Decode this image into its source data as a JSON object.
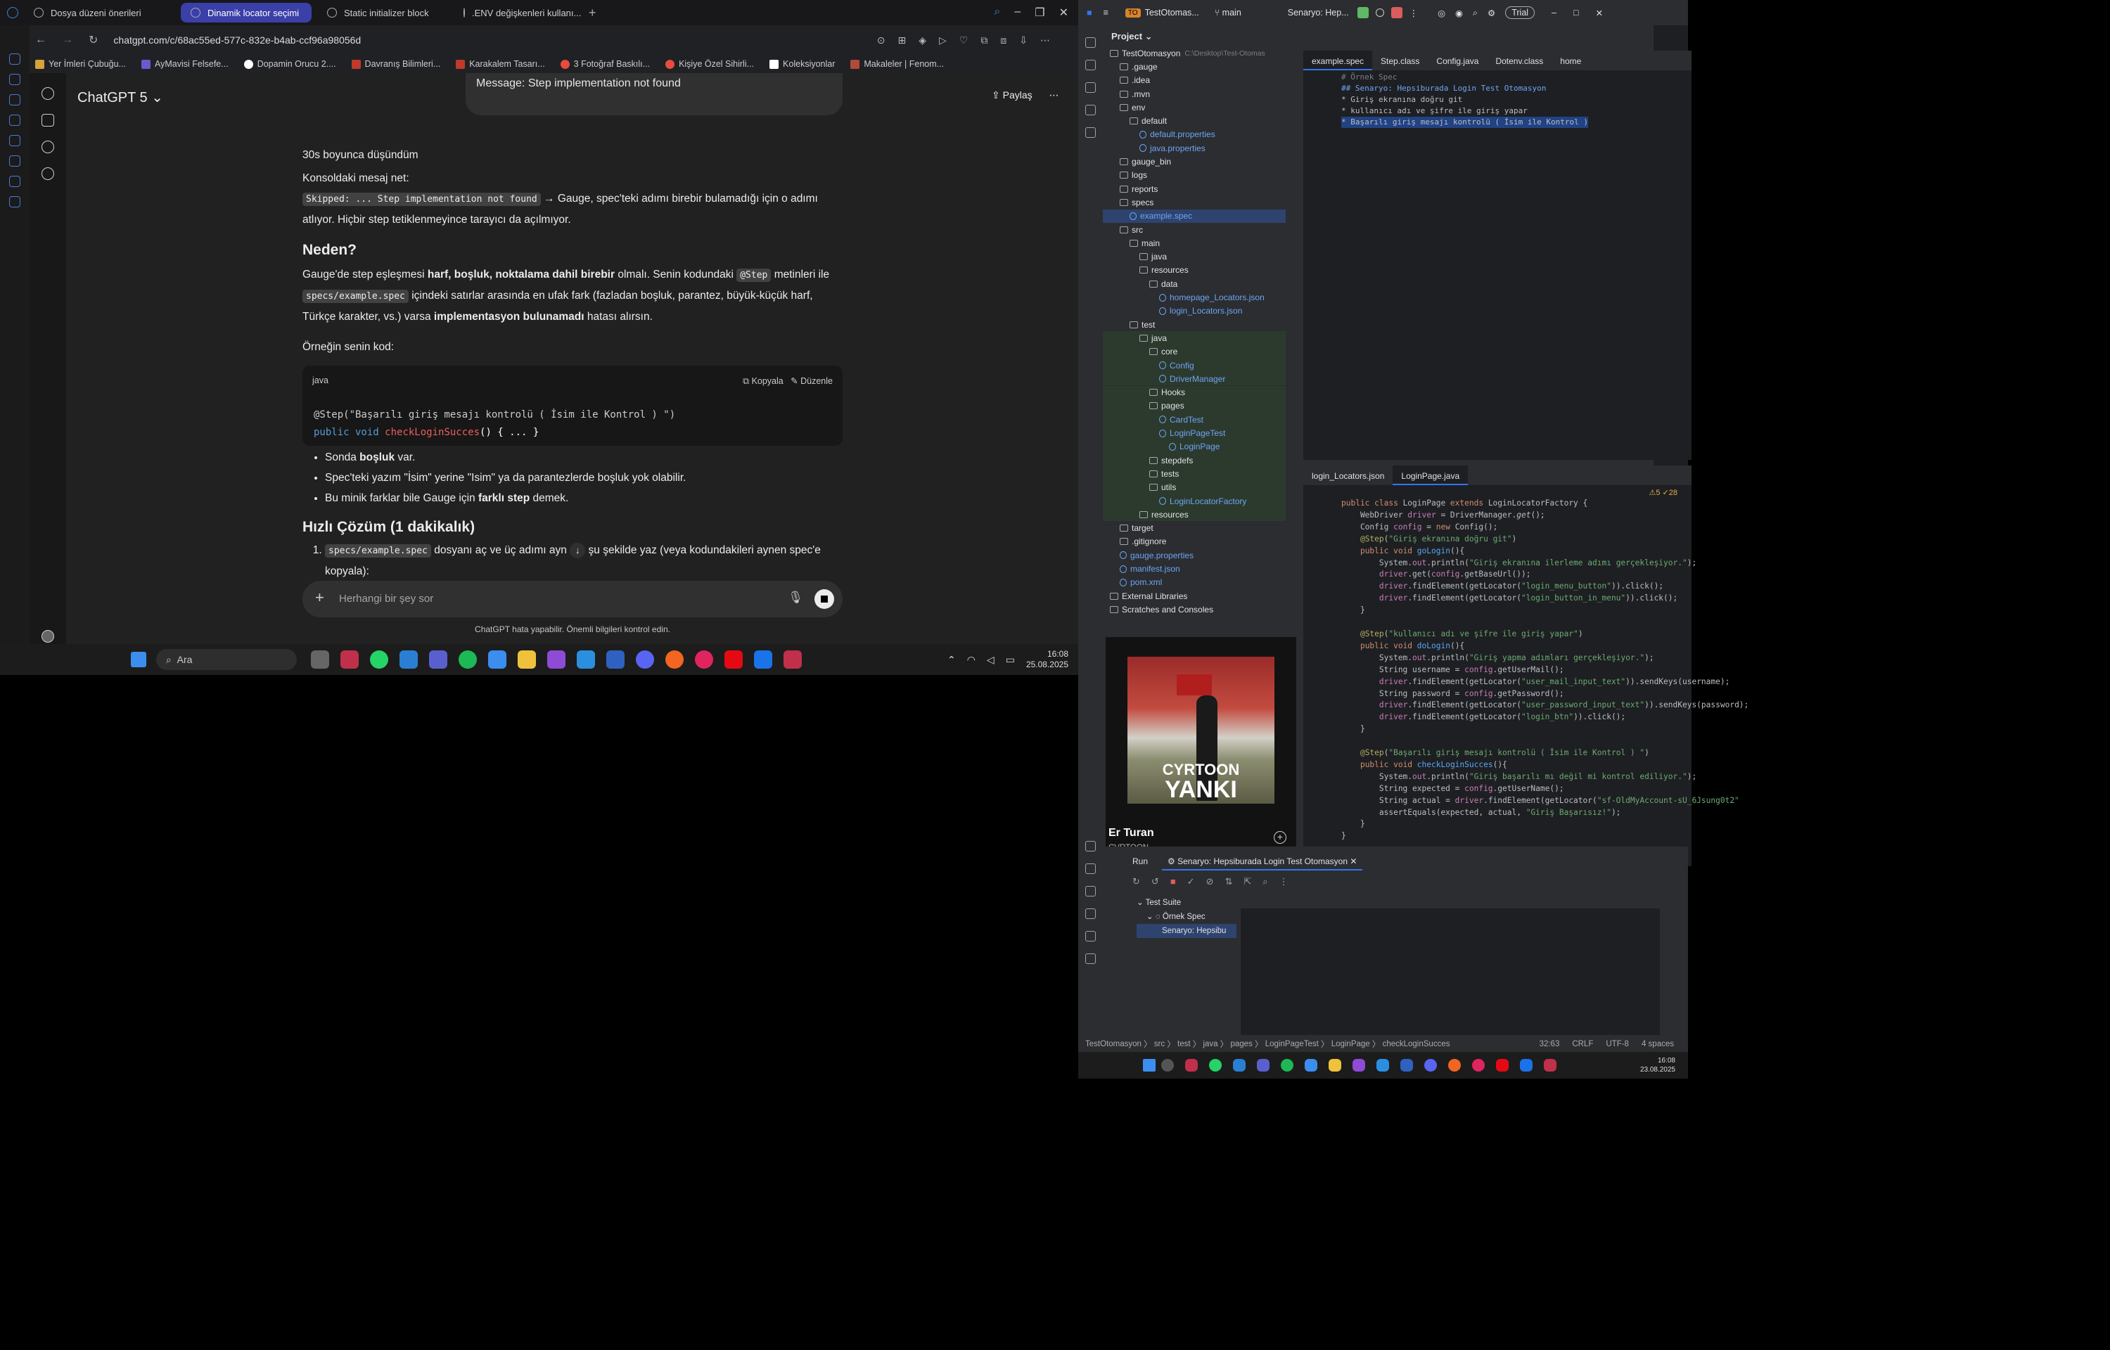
{
  "browser": {
    "tabs": [
      "Dosya düzeni önerileri",
      "Dinamik locator seçimi",
      "Static initializer block",
      ".ENV değişkenleri kullanı..."
    ],
    "url": "chatgpt.com/c/68ac55ed-577c-832e-b4ab-ccf96a98056d",
    "bookmarks": [
      "Yer İmleri Çubuğu...",
      "AyMavisi Felsefe...",
      "Dopamin Orucu 2....",
      "Davranış Bilimleri...",
      "Karakalem Tasarı...",
      "3 Fotoğraf Baskılı...",
      "Kişiye Özel Sihirli...",
      "Koleksiyonlar",
      "Makaleler | Fenom..."
    ]
  },
  "chatgpt": {
    "model": "ChatGPT 5",
    "share": "Paylaş",
    "user_message": "Message: Step implementation not found",
    "thought": "30s boyunca düşündüm",
    "p1": "Konsoldaki mesaj net:",
    "p2_code": "Skipped: ... Step implementation not found",
    "p2_rest": "→ Gauge, spec'teki adımı birebir bulamadığı için o adımı atlıyor. Hiçbir step tetiklenmeyince tarayıcı da açılmıyor.",
    "h_neden": "Neden?",
    "p3a": "Gauge'de step eşleşmesi",
    "p3b": "harf, boşluk, noktalama dahil birebir",
    "p3c": "olmalı. Senin kodundaki",
    "p3_code1": "@Step",
    "p3d": "metinleri ile",
    "p3_code2": "specs/example.spec",
    "p3e": "içindeki satırlar arasında en ufak fark (fazladan boşluk, parantez, büyük-küçük harf, Türkçe karakter, vs.) varsa",
    "p3f": "implementasyon bulunamadı",
    "p3g": "hatası alırsın.",
    "p4": "Örneğin senin kod:",
    "code_lang": "java",
    "copy": "Kopyala",
    "edit": "Düzenle",
    "code_line1": "@Step(\"Başarılı giriş mesajı kontrolü ( İsim ile Kontrol ) \")",
    "code_line2a": "public void ",
    "code_line2b": "checkLoginSucces",
    "code_line2c": "() { ... }",
    "bullet1a": "Sonda",
    "bullet1b": "boşluk",
    "bullet1c": "var.",
    "bullet2": "Spec'teki yazım \"İsim\" yerine \"Isim\" ya da parantezlerde boşluk yok olabilir.",
    "bullet3a": "Bu minik farklar bile Gauge için",
    "bullet3b": "farklı step",
    "bullet3c": "demek.",
    "h_cozum": "Hızlı Çözüm (1 dakikalık)",
    "step1_code": "specs/example.spec",
    "step1a": "dosyanı aç ve üç adımı ayn",
    "step1b": "şu şekilde yaz (veya kodundakileri aynen spec'e kopyala):",
    "placeholder": "Herhangi bir şey sor",
    "disclaimer": "ChatGPT hata yapabilir. Önemli bilgileri kontrol edin."
  },
  "taskbar_left": {
    "search": "Ara",
    "time": "16:08",
    "date": "25.08.2025"
  },
  "taskbar_right": {
    "time": "16:08",
    "date": "23.08.2025"
  },
  "ide": {
    "project_name": "TestOtomas...",
    "branch": "main",
    "run_config": "Senaryo: Hep...",
    "trial": "Trial",
    "project_label": "Project",
    "tree": [
      {
        "name": "TestOtomasyon",
        "depth": 0,
        "note": "C:\\Desktop\\Test-Otomas"
      },
      {
        "name": ".gauge",
        "depth": 1
      },
      {
        "name": ".idea",
        "depth": 1
      },
      {
        "name": ".mvn",
        "depth": 1
      },
      {
        "name": "env",
        "depth": 1
      },
      {
        "name": "default",
        "depth": 2
      },
      {
        "name": "default.properties",
        "depth": 3
      },
      {
        "name": "java.properties",
        "depth": 3
      },
      {
        "name": "gauge_bin",
        "depth": 1
      },
      {
        "name": "logs",
        "depth": 1
      },
      {
        "name": "reports",
        "depth": 1
      },
      {
        "name": "specs",
        "depth": 1
      },
      {
        "name": "example.spec",
        "depth": 2,
        "sel": true
      },
      {
        "name": "src",
        "depth": 1
      },
      {
        "name": "main",
        "depth": 2
      },
      {
        "name": "java",
        "depth": 3
      },
      {
        "name": "resources",
        "depth": 3
      },
      {
        "name": "data",
        "depth": 4
      },
      {
        "name": "homepage_Locators.json",
        "depth": 5
      },
      {
        "name": "login_Locators.json",
        "depth": 5
      },
      {
        "name": "test",
        "depth": 2
      },
      {
        "name": "java",
        "depth": 3,
        "g": true
      },
      {
        "name": "core",
        "depth": 4,
        "g": true
      },
      {
        "name": "Config",
        "depth": 5,
        "g": true
      },
      {
        "name": "DriverManager",
        "depth": 5,
        "g": true
      },
      {
        "name": "Hooks",
        "depth": 4,
        "g": true
      },
      {
        "name": "pages",
        "depth": 4,
        "g": true
      },
      {
        "name": "CardTest",
        "depth": 5,
        "g": true
      },
      {
        "name": "LoginPageTest",
        "depth": 5,
        "g": true
      },
      {
        "name": "LoginPage",
        "depth": 6,
        "g": true
      },
      {
        "name": "stepdefs",
        "depth": 4,
        "g": true
      },
      {
        "name": "tests",
        "depth": 4,
        "g": true
      },
      {
        "name": "utils",
        "depth": 4,
        "g": true
      },
      {
        "name": "LoginLocatorFactory",
        "depth": 5,
        "g": true
      },
      {
        "name": "resources",
        "depth": 3,
        "g": true
      },
      {
        "name": "target",
        "depth": 1
      },
      {
        "name": ".gitignore",
        "depth": 1
      },
      {
        "name": "gauge.properties",
        "depth": 1
      },
      {
        "name": "manifest.json",
        "depth": 1
      },
      {
        "name": "pom.xml",
        "depth": 1
      },
      {
        "name": "External Libraries",
        "depth": 0
      },
      {
        "name": "Scratches and Consoles",
        "depth": 0
      }
    ],
    "top_tabs": [
      "example.spec",
      "Step.class",
      "Config.java",
      "Dotenv.class",
      "home"
    ],
    "spec_lines": [
      "# Örnek Spec",
      "",
      "## Senaryo: Hepsiburada Login Test Otomasyon",
      "",
      "* Giriş ekranına doğru git",
      "* kullanıcı adı ve şifre ile giriş yapar",
      "* Başarılı giriş mesajı kontrolü ( İsim ile Kontrol )"
    ],
    "bottom_tabs": [
      "login_Locators.json",
      "LoginPage.java"
    ],
    "inspections": "⚠5  ✓28",
    "run_label": "Run",
    "run_tab": "Senaryo: Hepsiburada Login Test Otomasyon",
    "run_tree": [
      "Test Suite",
      "Örnek Spec",
      "Senaryo: Hepsibu"
    ],
    "breadcrumb": [
      "TestOtomasyon",
      "src",
      "test",
      "java",
      "pages",
      "LoginPageTest",
      "LoginPage",
      "checkLoginSucces"
    ],
    "status": [
      "32:63",
      "CRLF",
      "UTF-8",
      "4 spaces"
    ]
  },
  "spotify": {
    "album_text1": "CYRTOON",
    "album_text2": "YANKI",
    "song": "Er Turan",
    "artist": "CVRTOON"
  }
}
